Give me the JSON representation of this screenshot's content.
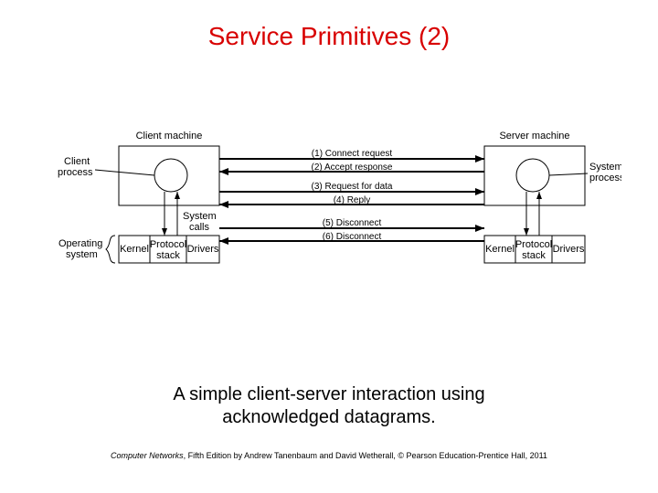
{
  "title": "Service Primitives (2)",
  "caption_line1": "A simple client-server interaction using",
  "caption_line2": "acknowledged datagrams.",
  "footer_title": "Computer Networks",
  "footer_rest": ", Fifth Edition by Andrew Tanenbaum and David Wetherall, © Pearson Education-Prentice Hall, 2011",
  "diagram": {
    "left_title": "Client machine",
    "right_title": "Server machine",
    "client_process": "Client\nprocess",
    "server_process": "System\nprocess",
    "system_calls": "System\ncalls",
    "os": "Operating\nsystem",
    "kernel": "Kernel",
    "protocol_stack": "Protocol\nstack",
    "drivers": "Drivers",
    "messages": {
      "m1": "(1) Connect request",
      "m2": "(2) Accept response",
      "m3": "(3) Request for data",
      "m4": "(4) Reply",
      "m5": "(5) Disconnect",
      "m6": "(6) Disconnect"
    }
  }
}
